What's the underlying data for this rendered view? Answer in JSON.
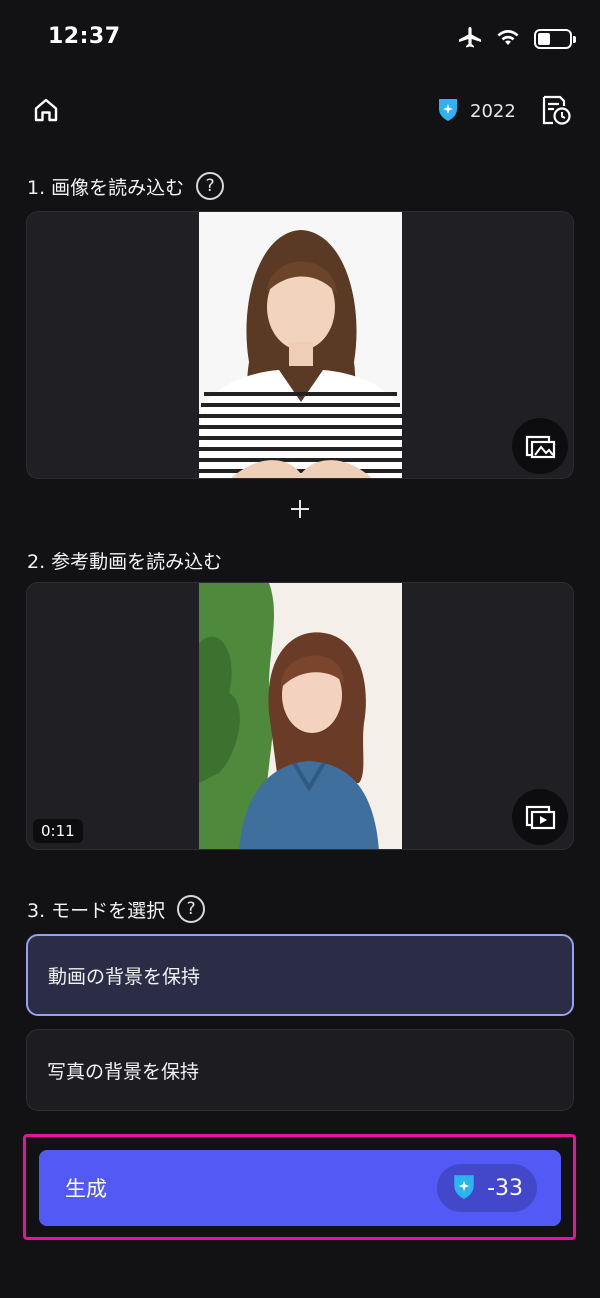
{
  "status_bar": {
    "time": "12:37"
  },
  "header": {
    "credits": "2022"
  },
  "step1": {
    "title": "1. 画像を読み込む",
    "help": "?"
  },
  "step2": {
    "title": "2. 参考動画を読み込む",
    "duration": "0:11"
  },
  "step3": {
    "title": "3. モードを選択",
    "help": "?"
  },
  "modes": [
    {
      "label": "動画の背景を保持",
      "selected": true
    },
    {
      "label": "写真の背景を保持",
      "selected": false
    }
  ],
  "generate": {
    "label": "生成",
    "cost": "-33"
  },
  "colors": {
    "accent": "#5359F5",
    "selected_border": "#9AA0F2",
    "highlight": "#E4159C",
    "credit_icon": "#2BB5F0"
  }
}
